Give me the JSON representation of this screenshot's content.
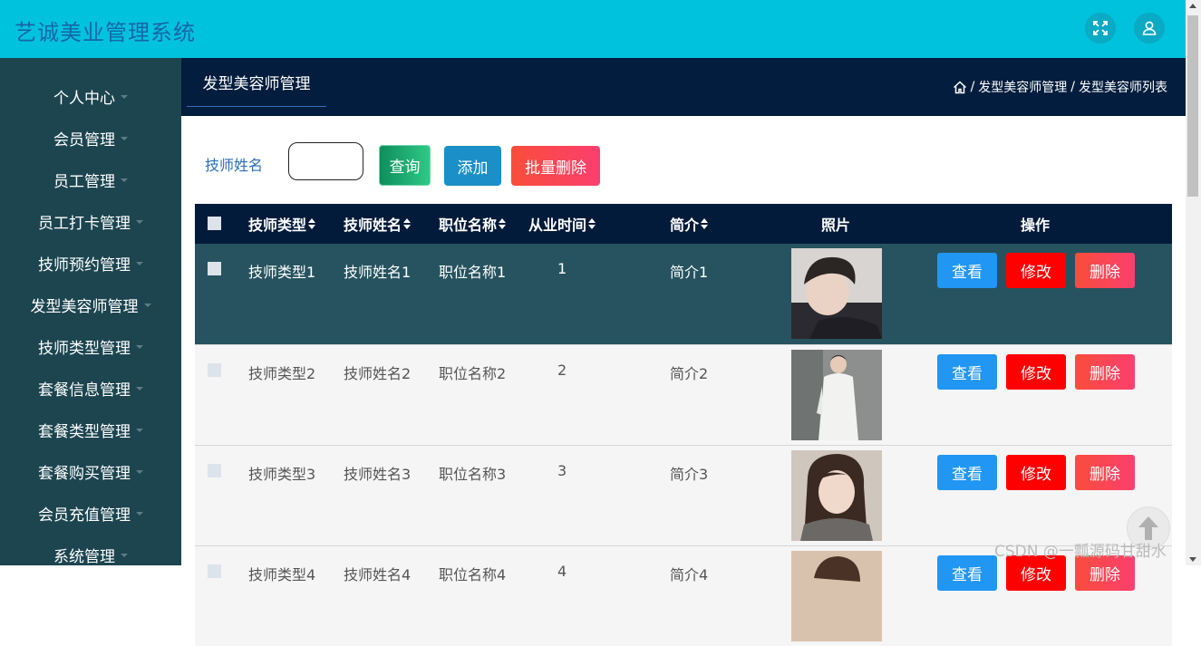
{
  "app": {
    "title": "艺诚美业管理系统",
    "icons": [
      "fullscreen-icon",
      "user-icon"
    ]
  },
  "sidebar": {
    "items": [
      {
        "label": "个人中心"
      },
      {
        "label": "会员管理"
      },
      {
        "label": "员工管理"
      },
      {
        "label": "员工打卡管理"
      },
      {
        "label": "技师预约管理"
      },
      {
        "label": "发型美容师管理"
      },
      {
        "label": "技师类型管理"
      },
      {
        "label": "套餐信息管理"
      },
      {
        "label": "套餐类型管理"
      },
      {
        "label": "套餐购买管理"
      },
      {
        "label": "会员充值管理"
      },
      {
        "label": "系统管理"
      }
    ]
  },
  "header": {
    "tab_label": "发型美容师管理",
    "breadcrumb": [
      "发型美容师管理",
      "发型美容师列表"
    ],
    "separator": "/"
  },
  "search": {
    "label": "技师姓名",
    "value": "",
    "buttons": {
      "query": "查询",
      "add": "添加",
      "batch_delete": "批量删除"
    }
  },
  "table": {
    "columns": {
      "type": "技师类型",
      "name": "技师姓名",
      "position": "职位名称",
      "years": "从业时间",
      "intro": "简介",
      "photo": "照片",
      "actions": "操作"
    },
    "rows": [
      {
        "type": "技师类型1",
        "name": "技师姓名1",
        "position": "职位名称1",
        "years": "1",
        "intro": "简介1"
      },
      {
        "type": "技师类型2",
        "name": "技师姓名2",
        "position": "职位名称2",
        "years": "2",
        "intro": "简介2"
      },
      {
        "type": "技师类型3",
        "name": "技师姓名3",
        "position": "职位名称3",
        "years": "3",
        "intro": "简介3"
      },
      {
        "type": "技师类型4",
        "name": "技师姓名4",
        "position": "职位名称4",
        "years": "4",
        "intro": "简介4"
      }
    ],
    "row_actions": {
      "view": "查看",
      "edit": "修改",
      "delete": "删除"
    }
  },
  "watermark": "CSDN @一瓢源码甘甜水",
  "colors": {
    "topbar": "#00c2dc",
    "sidebar": "#1c4550",
    "header": "#021d3d",
    "selected_row": "#26535f",
    "view": "#2196f3",
    "edit": "#ff0000",
    "delete": "#fb4656"
  }
}
